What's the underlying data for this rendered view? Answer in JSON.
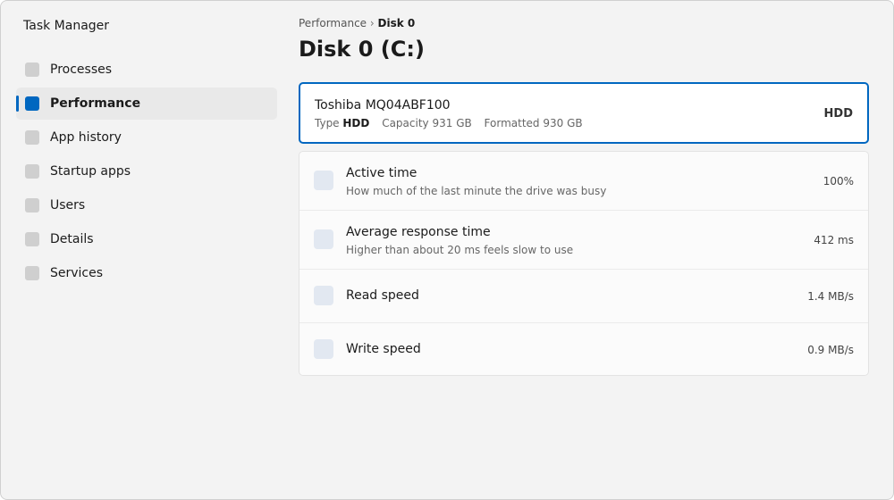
{
  "app": {
    "title": "Task Manager"
  },
  "sidebar": {
    "items": [
      {
        "label": "Processes",
        "selected": false
      },
      {
        "label": "Performance",
        "selected": true
      },
      {
        "label": "App history",
        "selected": false
      },
      {
        "label": "Startup apps",
        "selected": false
      },
      {
        "label": "Users",
        "selected": false
      },
      {
        "label": "Details",
        "selected": false
      },
      {
        "label": "Services",
        "selected": false
      }
    ]
  },
  "breadcrumb": {
    "parent": "Performance",
    "separator": "›",
    "current": "Disk 0"
  },
  "page": {
    "title": "Disk 0 (C:)"
  },
  "device": {
    "name": "Toshiba MQ04ABF100",
    "type_label": "Type",
    "type_value": "HDD",
    "capacity_label": "Capacity",
    "capacity_value": "931 GB",
    "formatted_label": "Formatted",
    "formatted_value": "930 GB",
    "badge": "HDD"
  },
  "metrics": [
    {
      "name": "Active time",
      "description": "How much of the last minute the drive was busy",
      "value": "100%"
    },
    {
      "name": "Average response time",
      "description": "Higher than about 20 ms feels slow to use",
      "value": "412 ms"
    },
    {
      "name": "Read speed",
      "description": "",
      "value": "1.4 MB/s"
    },
    {
      "name": "Write speed",
      "description": "",
      "value": "0.9 MB/s"
    }
  ],
  "colors": {
    "accent": "#0067c0",
    "background": "#f3f3f3",
    "card": "#ffffff",
    "icon_placeholder": "#e2e8f1"
  }
}
